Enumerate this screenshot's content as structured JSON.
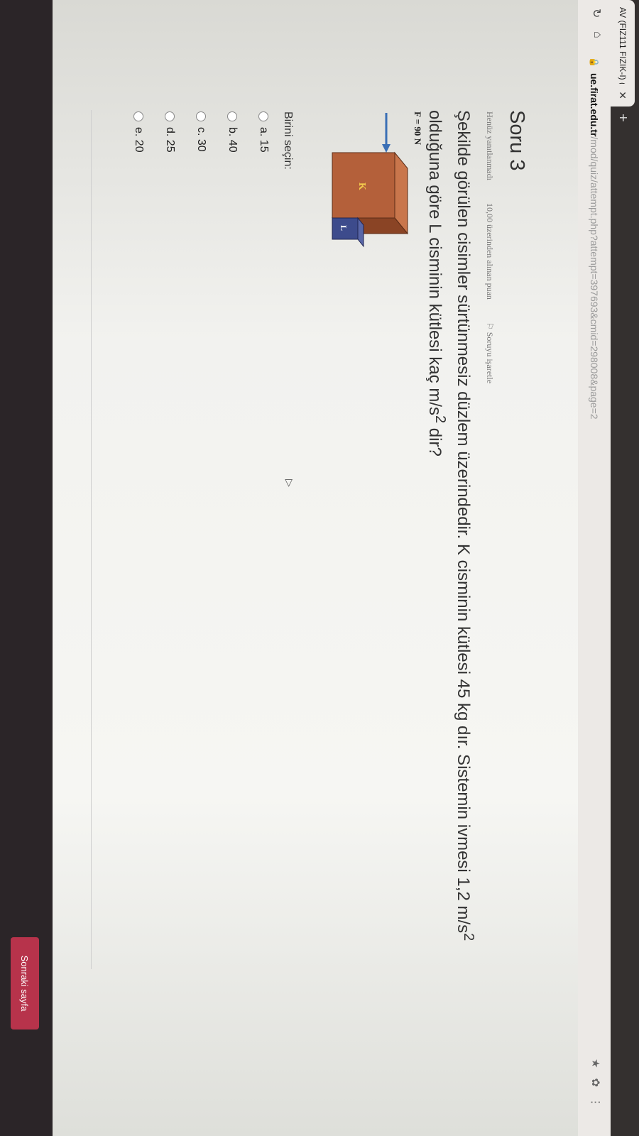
{
  "browser": {
    "tab_title": "AV (FIZ111 FIZIK-I) (say...",
    "url_host": "ue.firat.edu.tr",
    "url_path": "/mod/quiz/attempt.php?attempt=397693&cmid=298008&page=2"
  },
  "question": {
    "title": "Soru 3",
    "status": "Henüz yanıtlanmadı",
    "points": "10,00 üzerinden alınan puan",
    "flag_label": "Soruyu işaretle",
    "text_part1": "Şekilde görülen cisimler sürtünmesiz düzlem üzerindedir. K cisminin kütlesi 45 kg dır. Sistemin ivmesi 1,2 m/s",
    "text_exp1": "2",
    "text_part2": " olduğuna göre L cisminin kütlesi kaç m/s",
    "text_exp2": "2",
    "text_part3": " dir?",
    "figure": {
      "force_label": "F = 90 N",
      "block_k_label": "K",
      "block_l_label": "L",
      "colors": {
        "k_front": "#b4603a",
        "k_top": "#c9764c",
        "k_side": "#8a4425",
        "l_front": "#3d4b8c",
        "arrow": "#3a6fb5"
      }
    },
    "prompt": "Birini seçin:",
    "options": [
      {
        "label": "a. 15"
      },
      {
        "label": "b. 40"
      },
      {
        "label": "c. 30"
      },
      {
        "label": "d. 25"
      },
      {
        "label": "e. 20"
      }
    ]
  },
  "next_button": "Sonraki sayfa",
  "accent_color": "#b7334b"
}
